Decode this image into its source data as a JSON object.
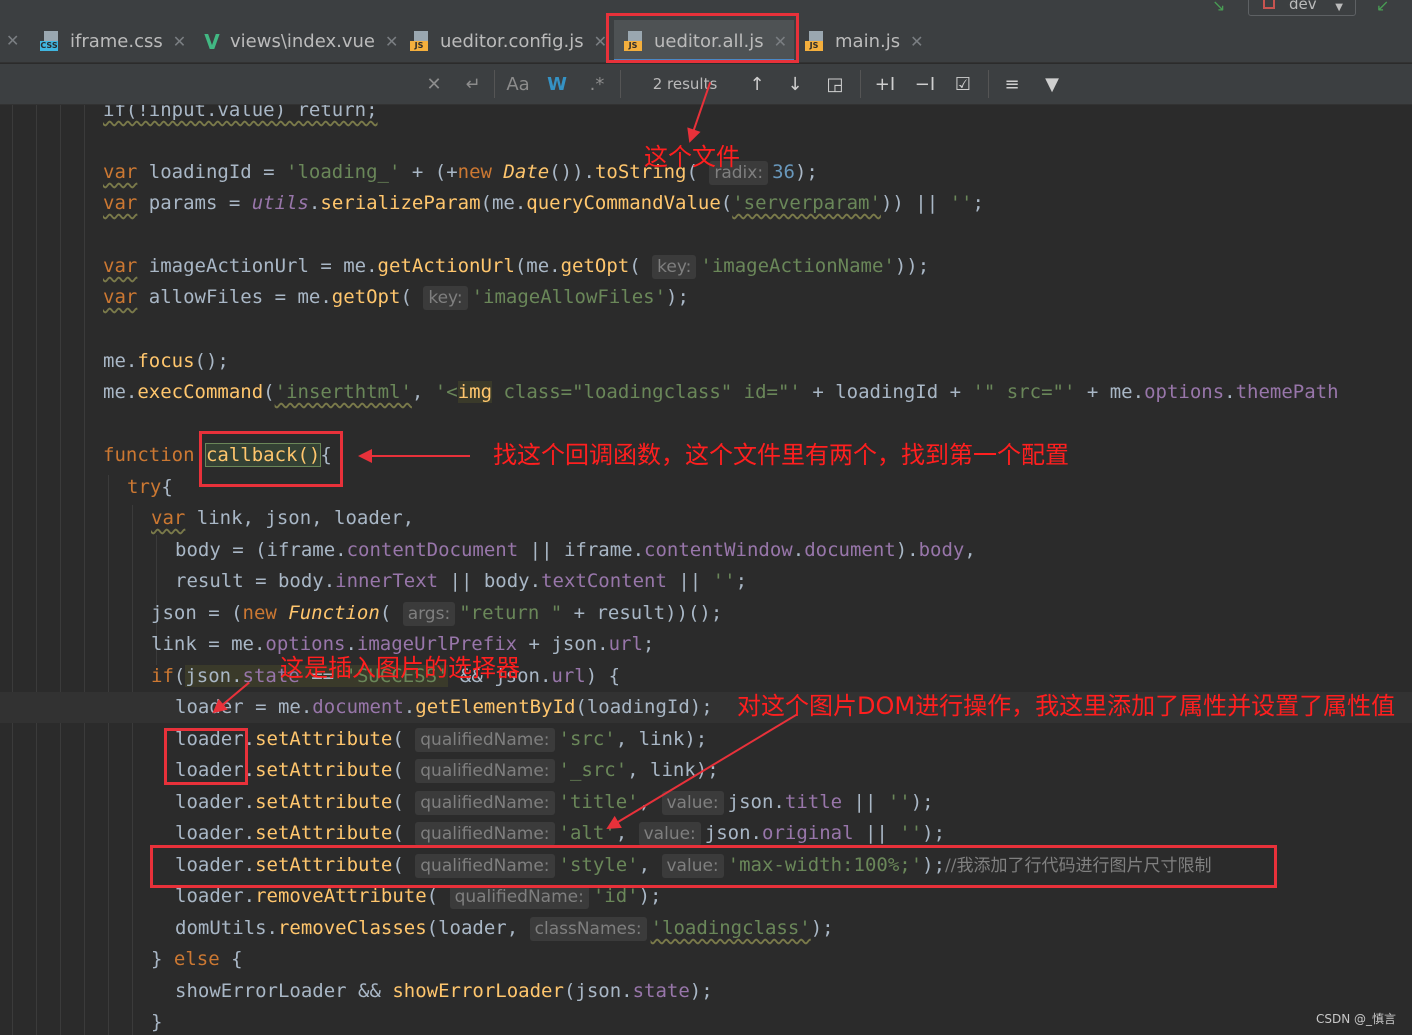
{
  "topbar": {
    "branch": "dev"
  },
  "tabs": [
    {
      "label": "iframe.css",
      "icon": "css-file-icon",
      "active": false
    },
    {
      "label": "views\\index.vue",
      "icon": "vue-file-icon",
      "active": false
    },
    {
      "label": "ueditor.config.js",
      "icon": "js-file-icon",
      "active": false
    },
    {
      "label": "ueditor.all.js",
      "icon": "js-file-icon",
      "active": true
    },
    {
      "label": "main.js",
      "icon": "js-file-icon",
      "active": false
    }
  ],
  "find": {
    "results": "2 results"
  },
  "hints": {
    "radix": "radix:",
    "key": "key:",
    "args": "args:",
    "qname": "qualifiedName:",
    "value": "value:",
    "classNames": "classNames:"
  },
  "code": {
    "l0": "if(!input.value) return;",
    "loadingPrefix": "'loading_'",
    "radix36": "36",
    "serverparam": "'serverparam'",
    "imageActionName": "'imageActionName'",
    "imageAllowFiles": "'imageAllowFiles'",
    "inserthtml": "'inserthtml'",
    "imgOpen": "'<",
    "imgTag": "img",
    "imgRest": " class=\"loadingclass\" id=\"'",
    "srcAttr": "'\" src=\"'",
    "themePath": "themePath",
    "callback": "callback()",
    "returnStr": "\"return \"",
    "success": "'SUCCESS'",
    "srcStr": "'src'",
    "_srcStr": "'_src'",
    "titleStr": "'title'",
    "altStr": "'alt'",
    "styleStr": "'style'",
    "maxWidth": "'max-width:100%;'",
    "comment": "//我添加了行代码进行图片尺寸限制",
    "idStr": "'id'",
    "loadingclass": "'loadingclass'"
  },
  "annotations": {
    "file": "这个文件",
    "callback": "找这个回调函数，这个文件里有两个，找到第一个配置",
    "selector": "这是插入图片的选择器",
    "dom": "对这个图片DOM进行操作，我这里添加了属性并设置了属性值"
  },
  "watermark": "CSDN @_慎言"
}
